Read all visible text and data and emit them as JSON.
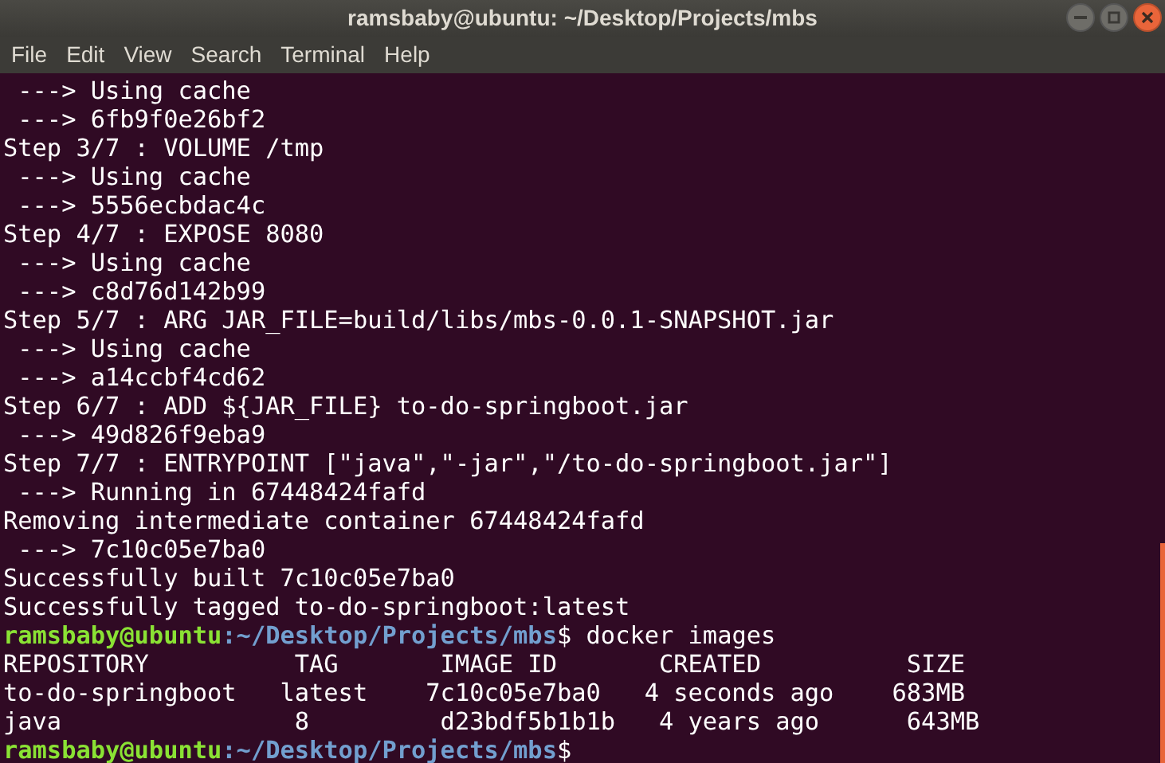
{
  "window": {
    "title": "ramsbaby@ubuntu: ~/Desktop/Projects/mbs"
  },
  "menu": [
    "File",
    "Edit",
    "View",
    "Search",
    "Terminal",
    "Help"
  ],
  "lines": [
    {
      "kind": "output",
      "text": " ---> Using cache"
    },
    {
      "kind": "output",
      "text": " ---> 6fb9f0e26bf2"
    },
    {
      "kind": "output",
      "text": "Step 3/7 : VOLUME /tmp"
    },
    {
      "kind": "output",
      "text": " ---> Using cache"
    },
    {
      "kind": "output",
      "text": " ---> 5556ecbdac4c"
    },
    {
      "kind": "output",
      "text": "Step 4/7 : EXPOSE 8080"
    },
    {
      "kind": "output",
      "text": " ---> Using cache"
    },
    {
      "kind": "output",
      "text": " ---> c8d76d142b99"
    },
    {
      "kind": "output",
      "text": "Step 5/7 : ARG JAR_FILE=build/libs/mbs-0.0.1-SNAPSHOT.jar"
    },
    {
      "kind": "output",
      "text": " ---> Using cache"
    },
    {
      "kind": "output",
      "text": " ---> a14ccbf4cd62"
    },
    {
      "kind": "output",
      "text": "Step 6/7 : ADD ${JAR_FILE} to-do-springboot.jar"
    },
    {
      "kind": "output",
      "text": " ---> 49d826f9eba9"
    },
    {
      "kind": "output",
      "text": "Step 7/7 : ENTRYPOINT [\"java\",\"-jar\",\"/to-do-springboot.jar\"]"
    },
    {
      "kind": "output",
      "text": " ---> Running in 67448424fafd"
    },
    {
      "kind": "output",
      "text": "Removing intermediate container 67448424fafd"
    },
    {
      "kind": "output",
      "text": " ---> 7c10c05e7ba0"
    },
    {
      "kind": "output",
      "text": "Successfully built 7c10c05e7ba0"
    },
    {
      "kind": "output",
      "text": "Successfully tagged to-do-springboot:latest"
    },
    {
      "kind": "prompt",
      "user": "ramsbaby@ubuntu",
      "path": ":~/Desktop/Projects/mbs",
      "symbol": "$",
      "command": "docker images"
    },
    {
      "kind": "output",
      "text": "REPOSITORY          TAG       IMAGE ID       CREATED          SIZE"
    },
    {
      "kind": "output",
      "text": "to-do-springboot   latest    7c10c05e7ba0   4 seconds ago    683MB"
    },
    {
      "kind": "output",
      "text": "java                8         d23bdf5b1b1b   4 years ago      643MB"
    },
    {
      "kind": "prompt",
      "user": "ramsbaby@ubuntu",
      "path": ":~/Desktop/Projects/mbs",
      "symbol": "$"
    }
  ]
}
